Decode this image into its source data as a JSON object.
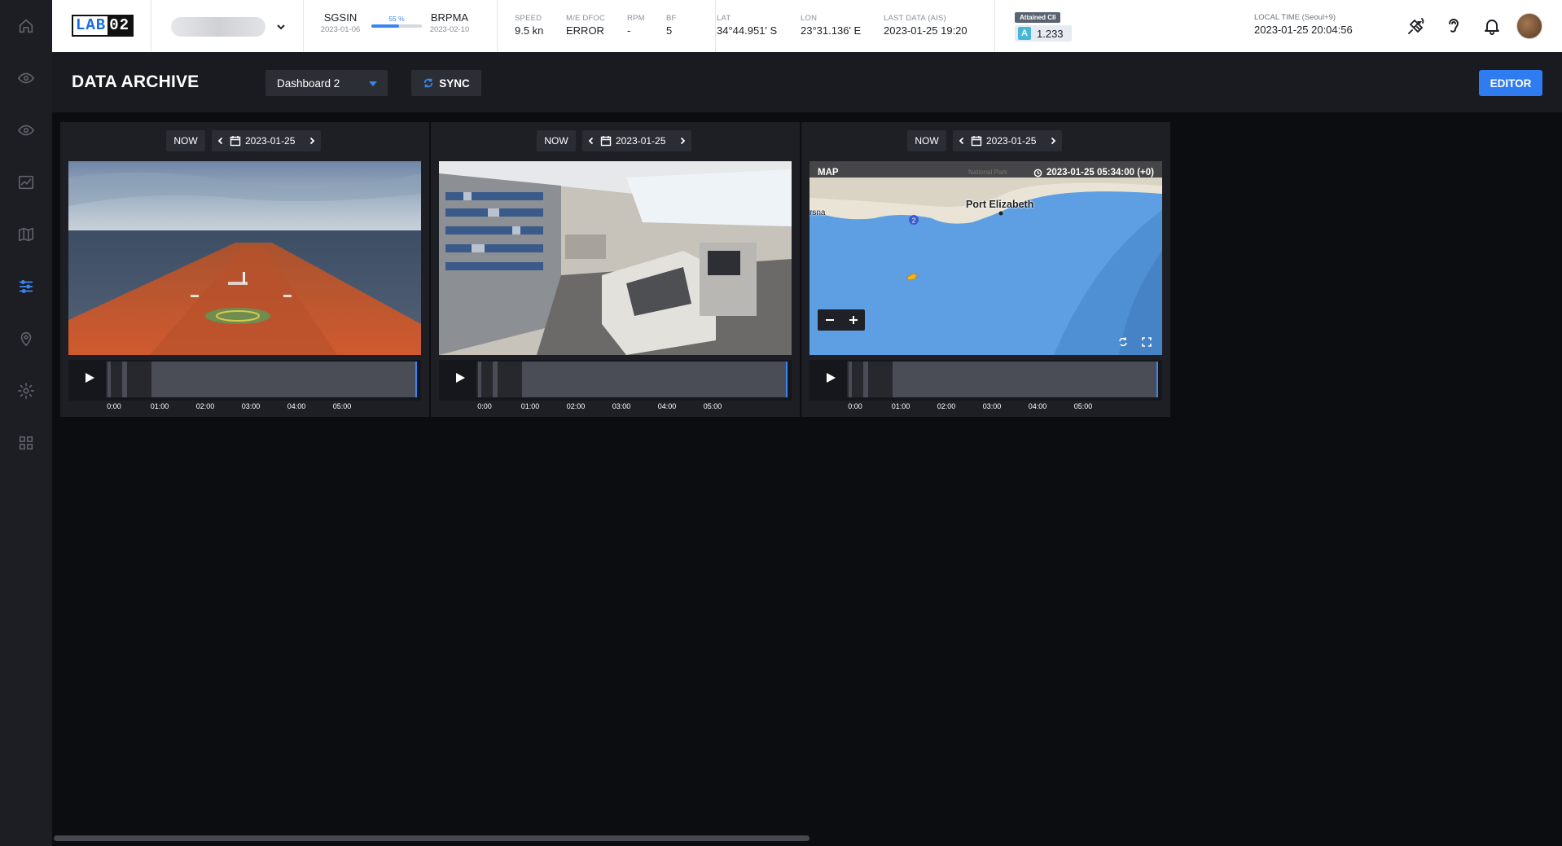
{
  "sidebar": {
    "items": [
      {
        "icon": "home-icon"
      },
      {
        "icon": "eye-icon"
      },
      {
        "icon": "eye-icon"
      },
      {
        "icon": "chart-icon"
      },
      {
        "icon": "map-icon"
      },
      {
        "icon": "sliders-icon",
        "active": true
      },
      {
        "icon": "location-icon"
      },
      {
        "icon": "gear-icon"
      },
      {
        "icon": "grid-icon"
      }
    ]
  },
  "topbar": {
    "logo_a": "LAB",
    "logo_b": "02",
    "voyage": {
      "from_code": "SGSIN",
      "from_date": "2023-01-06",
      "to_code": "BRPMA",
      "to_date": "2023-02-10",
      "progress_pct": 55,
      "progress_label": "55 %"
    },
    "speed": {
      "label": "SPEED",
      "value": "9.5 kn"
    },
    "me_dfoc": {
      "label": "M/E DFOC",
      "value": "ERROR"
    },
    "rpm": {
      "label": "RPM",
      "value": "-"
    },
    "bf": {
      "label": "BF",
      "value": "5"
    },
    "lat": {
      "label": "LAT",
      "value": "34°44.951' S"
    },
    "lon": {
      "label": "LON",
      "value": "23°31.136' E"
    },
    "last_data": {
      "label": "LAST DATA (AIS)",
      "value": "2023-01-25 19:20"
    },
    "cii": {
      "label": "Attained CII",
      "grade": "A",
      "value": "1.233"
    },
    "local_time": {
      "label": "LOCAL TIME (Seoul+9)",
      "value": "2023-01-25 20:04:56"
    },
    "icons": [
      "satellite-off-icon",
      "hearing-icon",
      "bell-icon"
    ]
  },
  "page": {
    "title": "DATA ARCHIVE",
    "dashboard_select": "Dashboard 2",
    "sync_label": "SYNC",
    "editor_label": "EDITOR"
  },
  "panels": [
    {
      "now_label": "NOW",
      "date": "2023-01-25",
      "type": "camera-bow",
      "ticks": [
        "0:00",
        "01:00",
        "02:00",
        "03:00",
        "04:00",
        "05:00"
      ]
    },
    {
      "now_label": "NOW",
      "date": "2023-01-25",
      "type": "camera-bridge",
      "ticks": [
        "0:00",
        "01:00",
        "02:00",
        "03:00",
        "04:00",
        "05:00"
      ]
    },
    {
      "now_label": "NOW",
      "date": "2023-01-25",
      "type": "map",
      "ticks": [
        "0:00",
        "01:00",
        "02:00",
        "03:00",
        "04:00",
        "05:00"
      ],
      "map": {
        "title": "MAP",
        "timestamp": "2023-01-25 05:34:00 (+0)",
        "city": "Port Elizabeth",
        "partial_label": "rsna",
        "route_badge": "2",
        "park_label": "National Park"
      }
    }
  ],
  "colors": {
    "accent": "#3a86f0",
    "sidebar": "#1c1e23",
    "panel": "#1d1f25",
    "background": "#0c0d10",
    "hull": "#c4502c",
    "sea": "#5b9fe0"
  }
}
